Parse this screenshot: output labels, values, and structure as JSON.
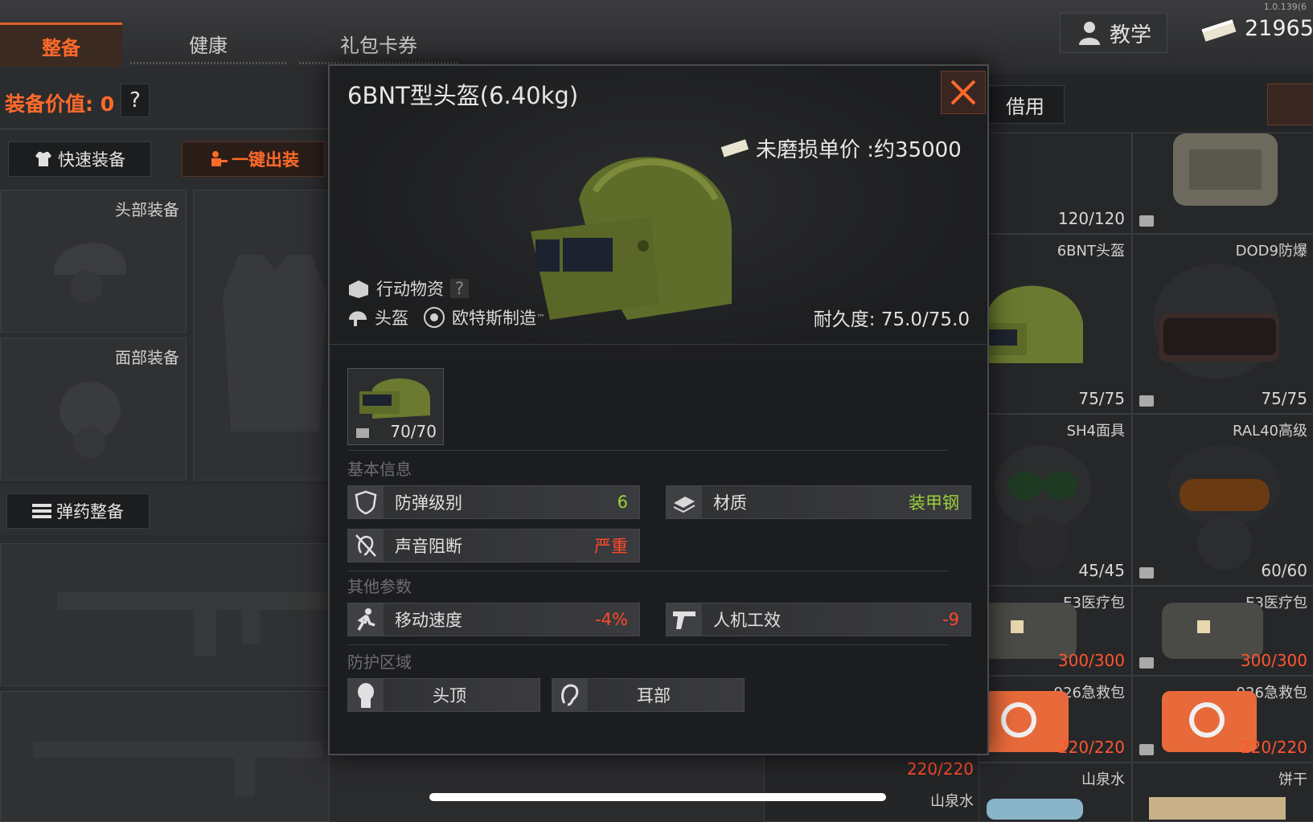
{
  "version": "1.0.139(6",
  "tabs": [
    {
      "label": "整备",
      "active": true
    },
    {
      "label": "健康",
      "active": false
    },
    {
      "label": "礼包卡券",
      "active": false
    }
  ],
  "topbar": {
    "tutorial_label": "教学",
    "currency": "21965"
  },
  "left": {
    "equip_value_label": "装备价值: 0",
    "help": "?",
    "quick_equip": "快速装备",
    "one_click_deploy": "一键出装",
    "head_slot": "头部装备",
    "face_slot": "面部装备",
    "ammo_button": "弹药整备"
  },
  "right": {
    "borrow_label": "借用",
    "cells": [
      {
        "name": "",
        "dur": "120/120",
        "red": false
      },
      {
        "name": "",
        "dur": "",
        "red": false
      },
      {
        "name": "6BNT头盔",
        "dur": "75/75",
        "red": false
      },
      {
        "name": "DOD9防爆",
        "dur": "75/75",
        "red": false
      },
      {
        "name": "SH4面具",
        "dur": "45/45",
        "red": false
      },
      {
        "name": "RAL40高级",
        "dur": "60/60",
        "red": false
      },
      {
        "name": "E3医疗包",
        "dur": "300/300",
        "red": true
      },
      {
        "name": "E3医疗包",
        "dur": "300/300",
        "red": true
      },
      {
        "name": "926急救包",
        "dur": "220/220",
        "red": true
      },
      {
        "name": "926急救包",
        "dur": "220/220",
        "red": true
      },
      {
        "name": "山泉水",
        "dur": "",
        "red": false
      },
      {
        "name": "饼干",
        "dur": "",
        "red": false
      }
    ],
    "under_modal_dur": "220/220",
    "under_modal_name": "山泉水"
  },
  "modal": {
    "title": "6BNT型头盔(6.40kg)",
    "price": "未磨损单价 :约35000",
    "tag_supply": "行动物资",
    "tag_help": "?",
    "type": "头盔",
    "maker": "欧特斯制造",
    "tm": "™",
    "durability": "耐久度: 75.0/75.0",
    "thumb_dur": "70/70",
    "section_basic": "基本信息",
    "section_other": "其他参数",
    "section_protect": "防护区域",
    "stats_basic": [
      {
        "label": "防弹级别",
        "value": "6",
        "color": "green"
      },
      {
        "label": "材质",
        "value": "装甲钢",
        "color": "green"
      },
      {
        "label": "声音阻断",
        "value": "严重",
        "color": "red"
      }
    ],
    "stats_other": [
      {
        "label": "移动速度",
        "value": "-4%",
        "color": "red"
      },
      {
        "label": "人机工效",
        "value": "-9",
        "color": "red"
      }
    ],
    "zones": [
      "头顶",
      "耳部"
    ],
    "colors": {
      "accent": "#ff6a2a",
      "good": "#9ad13a",
      "bad": "#ff4a2a",
      "helmet": "#5b6a2a"
    }
  }
}
